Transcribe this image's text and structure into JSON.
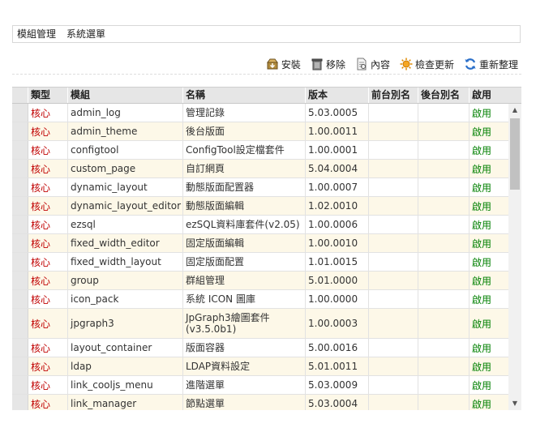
{
  "breadcrumb": [
    "模組管理",
    "系統選單"
  ],
  "toolbar": {
    "install": "安裝",
    "remove": "移除",
    "content": "內容",
    "check_update": "檢查更新",
    "reorganize": "重新整理"
  },
  "columns": {
    "type": "類型",
    "module": "模組",
    "name": "名稱",
    "version": "版本",
    "front_alias": "前台別名",
    "back_alias": "後台別名",
    "enabled": "啟用"
  },
  "rows": [
    {
      "type": "核心",
      "module": "admin_log",
      "name": "管理記錄",
      "version": "5.03.0005",
      "enabled": "啟用"
    },
    {
      "type": "核心",
      "module": "admin_theme",
      "name": "後台版面",
      "version": "1.00.0011",
      "enabled": "啟用"
    },
    {
      "type": "核心",
      "module": "configtool",
      "name": "ConfigTool設定檔套件",
      "version": "1.00.0001",
      "enabled": "啟用"
    },
    {
      "type": "核心",
      "module": "custom_page",
      "name": "自訂網頁",
      "version": "5.04.0004",
      "enabled": "啟用"
    },
    {
      "type": "核心",
      "module": "dynamic_layout",
      "name": "動態版面配置器",
      "version": "1.00.0007",
      "enabled": "啟用"
    },
    {
      "type": "核心",
      "module": "dynamic_layout_editor",
      "name": "動態版面編輯",
      "version": "1.02.0010",
      "enabled": "啟用"
    },
    {
      "type": "核心",
      "module": "ezsql",
      "name": "ezSQL資料庫套件(v2.05)",
      "version": "1.00.0006",
      "enabled": "啟用"
    },
    {
      "type": "核心",
      "module": "fixed_width_editor",
      "name": "固定版面編輯",
      "version": "1.00.0010",
      "enabled": "啟用"
    },
    {
      "type": "核心",
      "module": "fixed_width_layout",
      "name": "固定版面配置",
      "version": "1.01.0015",
      "enabled": "啟用"
    },
    {
      "type": "核心",
      "module": "group",
      "name": "群組管理",
      "version": "5.01.0000",
      "enabled": "啟用"
    },
    {
      "type": "核心",
      "module": "icon_pack",
      "name": "系統 ICON 圖庫",
      "version": "1.00.0000",
      "enabled": "啟用"
    },
    {
      "type": "核心",
      "module": "jpgraph3",
      "name": "JpGraph3繪圖套件(v3.5.0b1)",
      "version": "1.00.0003",
      "enabled": "啟用"
    },
    {
      "type": "核心",
      "module": "layout_container",
      "name": "版面容器",
      "version": "5.00.0016",
      "enabled": "啟用"
    },
    {
      "type": "核心",
      "module": "ldap",
      "name": "LDAP資料設定",
      "version": "5.01.0011",
      "enabled": "啟用"
    },
    {
      "type": "核心",
      "module": "link_cooljs_menu",
      "name": "進階選單",
      "version": "5.03.0009",
      "enabled": "啟用"
    },
    {
      "type": "核心",
      "module": "link_manager",
      "name": "節點選單",
      "version": "5.03.0004",
      "enabled": "啟用"
    }
  ],
  "colors": {
    "core_type": "#c00000",
    "enabled": "#008000",
    "row_alt": "#fdf8e8",
    "header_bg": "#e6e6e6"
  },
  "icons": {
    "install": "box-install-icon",
    "remove": "trash-can-icon",
    "content": "document-icon",
    "check_update": "sun-update-icon",
    "reorganize": "refresh-icon"
  }
}
